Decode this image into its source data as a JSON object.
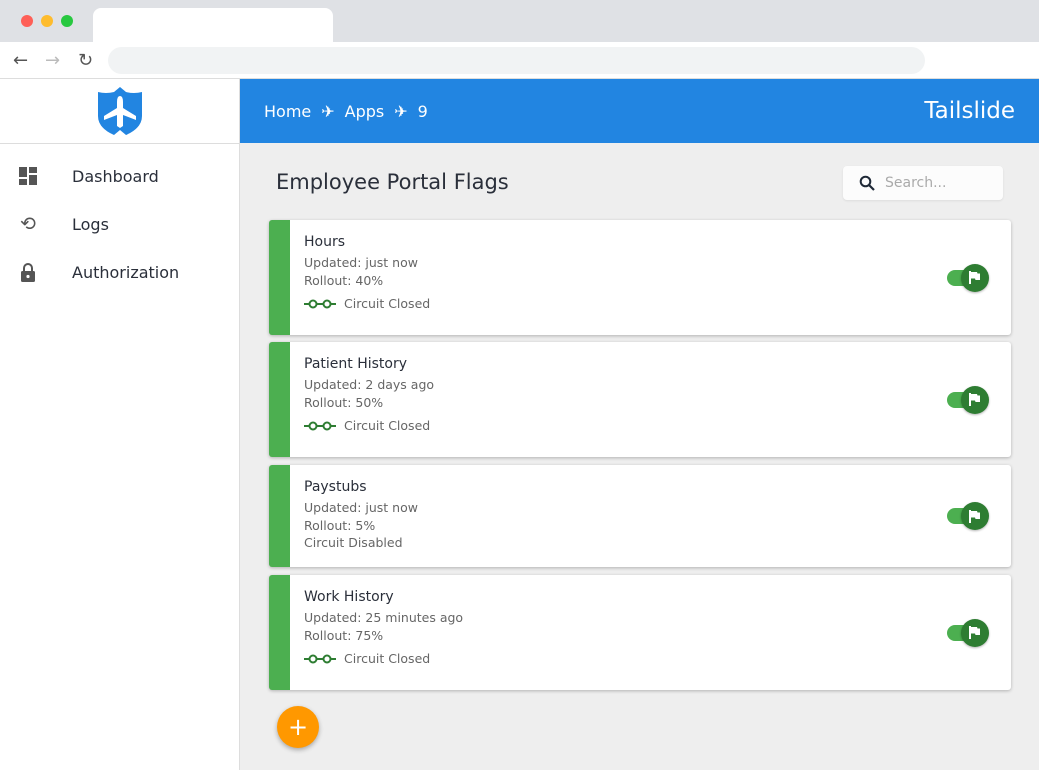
{
  "browser": {
    "tab_title": "",
    "url": ""
  },
  "sidebar": {
    "items": [
      {
        "label": "Dashboard",
        "icon": "dashboard-icon"
      },
      {
        "label": "Logs",
        "icon": "history-icon"
      },
      {
        "label": "Authorization",
        "icon": "lock-icon"
      }
    ]
  },
  "header": {
    "breadcrumbs": [
      "Home",
      "Apps",
      "9"
    ],
    "brand": "Tailslide"
  },
  "main": {
    "title": "Employee Portal Flags",
    "search_placeholder": "Search...",
    "flags": [
      {
        "name": "Hours",
        "updated": "Updated: just now",
        "rollout": "Rollout: 40%",
        "circuit": "Circuit Closed",
        "enabled": true
      },
      {
        "name": "Patient History",
        "updated": "Updated: 2 days ago",
        "rollout": "Rollout: 50%",
        "circuit": "Circuit Closed",
        "enabled": true
      },
      {
        "name": "Paystubs",
        "updated": "Updated: just now",
        "rollout": "Rollout: 5%",
        "circuit": "Circuit Disabled",
        "enabled": true
      },
      {
        "name": "Work History",
        "updated": "Updated: 25 minutes ago",
        "rollout": "Rollout: 75%",
        "circuit": "Circuit Closed",
        "enabled": true
      }
    ],
    "fab_label": "+"
  },
  "colors": {
    "primary": "#2285e1",
    "success": "#4caf50",
    "fab": "#ff9800"
  }
}
